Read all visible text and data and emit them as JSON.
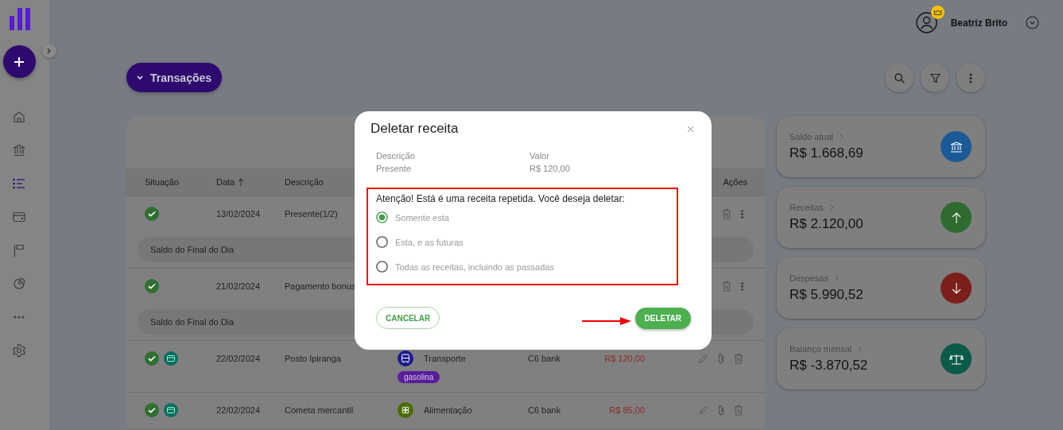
{
  "sidebar": {
    "items": [
      {
        "kind": "home",
        "selected": false
      },
      {
        "kind": "bank",
        "selected": false
      },
      {
        "kind": "list",
        "selected": true
      },
      {
        "kind": "wallet",
        "selected": false
      },
      {
        "kind": "flag",
        "selected": false
      },
      {
        "kind": "chart",
        "selected": false
      },
      {
        "kind": "more",
        "selected": false
      },
      {
        "kind": "settings",
        "selected": false
      }
    ]
  },
  "header": {
    "user_name": "Beatriz Brito",
    "premium": true
  },
  "page_menu": {
    "label": "Transações"
  },
  "table": {
    "columns": [
      {
        "label": "Situação",
        "kind": "status",
        "sorted": false
      },
      {
        "label": "Data",
        "kind": "date",
        "sorted": true
      },
      {
        "label": "Descrição",
        "kind": "description",
        "sorted": false
      },
      {
        "label": "Ações",
        "kind": "actions",
        "sorted": false
      }
    ],
    "rows": [
      {
        "paid": true,
        "date": "13/02/2024",
        "description": "Presente(1/2)",
        "actions": [
          {
            "kind": "delete"
          },
          {
            "kind": "more"
          }
        ],
        "day_balance": "Saldo do Final do Dia"
      },
      {
        "paid": true,
        "date": "21/02/2024",
        "description": "Pagamento bonus",
        "actions": [
          {
            "kind": "delete"
          },
          {
            "kind": "more"
          }
        ],
        "day_balance": "Saldo do Final do Dia"
      },
      {
        "paid": true,
        "card": true,
        "date": "22/02/2024",
        "description": "Posto Ipiranga",
        "category": {
          "name": "Transporte",
          "kind": "bus",
          "color": "#1c1c8c"
        },
        "tag": "gasolina",
        "account": "C6 bank",
        "value": "R$ 120,00",
        "actions": [
          {
            "kind": "edit"
          },
          {
            "kind": "attach"
          },
          {
            "kind": "delete"
          }
        ]
      },
      {
        "paid": true,
        "card": true,
        "date": "22/02/2024",
        "description": "Cometa mercantil",
        "category": {
          "name": "Alimentação",
          "kind": "food",
          "color": "#4b6b00"
        },
        "account": "C6 bank",
        "value": "R$ 85,00",
        "actions": [
          {
            "kind": "edit"
          },
          {
            "kind": "attach"
          },
          {
            "kind": "delete"
          }
        ]
      }
    ]
  },
  "summary": [
    {
      "label": "Saldo atual",
      "value": "R$ 1.668,69",
      "kind": "bank",
      "color": "#1a5a96"
    },
    {
      "label": "Receitas",
      "value": "R$ 2.120,00",
      "kind": "up",
      "color": "#2e6b2e"
    },
    {
      "label": "Despesas",
      "value": "R$ 5.990,52",
      "kind": "down",
      "color": "#7a1f1a"
    },
    {
      "label": "Balanço mensal",
      "value": "R$ -3.870,52",
      "kind": "balance",
      "color": "#0b5a4a"
    }
  ],
  "dialog": {
    "title": "Deletar receita",
    "fields": [
      {
        "label": "Descrição",
        "value": "Presente"
      },
      {
        "label": "Valor",
        "value": "R$ 120,00"
      }
    ],
    "warning": "Atenção! Está é uma receita repetida. Você deseja deletar:",
    "options": [
      {
        "label": "Somente esta",
        "selected": true
      },
      {
        "label": "Esta, e as futuras",
        "selected": false
      },
      {
        "label": "Todas as receitas, incluindo as passadas",
        "selected": false
      }
    ],
    "cancel": "CANCELAR",
    "confirm": "DELETAR"
  }
}
